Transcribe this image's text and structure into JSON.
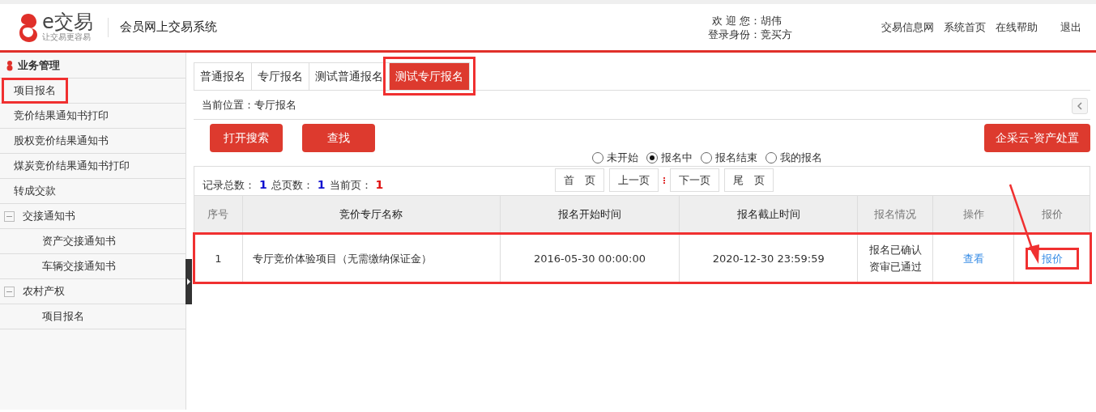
{
  "header": {
    "logo_text": "e交易",
    "logo_slogan": "让交易更容易",
    "system_title": "会员网上交易系统",
    "welcome_label": "欢 迎 您：",
    "welcome_name": "胡伟",
    "role_label": "登录身份：",
    "role_name": "竞买方",
    "nav_links": [
      "交易信息网",
      "系统首页",
      "在线帮助",
      "退出"
    ]
  },
  "sidebar": {
    "title": "业务管理",
    "items": [
      {
        "kind": "item",
        "label": "项目报名",
        "annotated": true
      },
      {
        "kind": "item",
        "label": "竞价结果通知书打印",
        "annotated": false
      },
      {
        "kind": "item",
        "label": "股权竞价结果通知书",
        "annotated": false
      },
      {
        "kind": "item",
        "label": "煤炭竞价结果通知书打印",
        "annotated": false
      },
      {
        "kind": "item",
        "label": "转成交款",
        "annotated": false
      },
      {
        "kind": "group",
        "label": "交接通知书",
        "expanded": true,
        "children": [
          {
            "kind": "item",
            "label": "资产交接通知书",
            "annotated": false
          },
          {
            "kind": "item",
            "label": "车辆交接通知书",
            "annotated": false
          }
        ]
      },
      {
        "kind": "group",
        "label": "农村产权",
        "expanded": true,
        "children": [
          {
            "kind": "item",
            "label": "项目报名",
            "annotated": false
          }
        ]
      }
    ]
  },
  "tabs": [
    {
      "label": "普通报名",
      "selected": false,
      "annotated": false
    },
    {
      "label": "专厅报名",
      "selected": false,
      "annotated": false
    },
    {
      "label": "测试普通报名",
      "selected": false,
      "annotated": false
    },
    {
      "label": "测试专厅报名",
      "selected": true,
      "annotated": true
    }
  ],
  "breadcrumb": "当前位置：专厅报名",
  "buttons": [
    "打开搜索",
    "查找"
  ],
  "right_button": "企采云-资产处置",
  "filters": [
    {
      "label": "未开始",
      "selected": false
    },
    {
      "label": "报名中",
      "selected": true
    },
    {
      "label": "报名结束",
      "selected": false
    },
    {
      "label": "我的报名",
      "selected": false
    }
  ],
  "stats": [
    {
      "label": "记录总数：",
      "value": "1",
      "color": "#1010d0"
    },
    {
      "label": "总页数：",
      "value": "1",
      "color": "#1010d0"
    },
    {
      "label": "当前页：",
      "value": "1",
      "color": "#e01010"
    }
  ],
  "pager": [
    "首　页",
    "上一页",
    "下一页",
    "尾　页"
  ],
  "table": {
    "columns": [
      "序号",
      "竞价专厅名称",
      "报名开始时间",
      "报名截止时间",
      "报名情况",
      "操作",
      "报价"
    ],
    "rows": [
      {
        "annotated": true,
        "cells": [
          "1",
          "专厅竞价体验项目（无需缴纳保证金）",
          "2016-05-30 00:00:00",
          "2020-12-30 23:59:59"
        ],
        "status": [
          "报名已确认",
          "资审已通过"
        ],
        "view_link": "查看",
        "quote_link": "报价",
        "quote_annotated": true
      }
    ]
  }
}
